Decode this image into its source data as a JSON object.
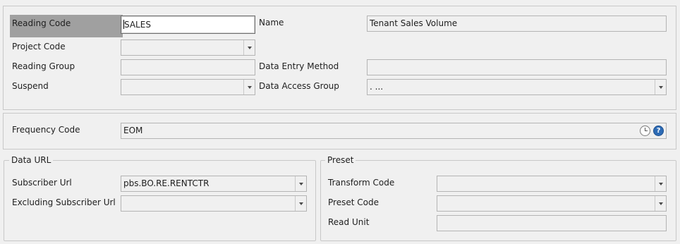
{
  "general": {
    "reading_code": {
      "label": "Reading Code",
      "value": "SALES"
    },
    "name": {
      "label": "Name",
      "value": "Tenant Sales Volume"
    },
    "project_code": {
      "label": "Project Code",
      "value": ""
    },
    "reading_group": {
      "label": "Reading Group",
      "value": ""
    },
    "data_entry_method": {
      "label": "Data Entry Method",
      "value": ""
    },
    "suspend": {
      "label": "Suspend",
      "value": ""
    },
    "data_access_group": {
      "label": "Data Access Group",
      "value": ". ..."
    }
  },
  "frequency": {
    "frequency_code": {
      "label": "Frequency Code",
      "value": "EOM"
    },
    "help_glyph": "?"
  },
  "data_url": {
    "legend": "Data URL",
    "subscriber_url": {
      "label": "Subscriber Url",
      "value": "pbs.BO.RE.RENTCTR"
    },
    "excluding_subscriber_url": {
      "label": "Excluding Subscriber Url",
      "value": ""
    }
  },
  "preset": {
    "legend": "Preset",
    "transform_code": {
      "label": "Transform Code",
      "value": ""
    },
    "preset_code": {
      "label": "Preset Code",
      "value": ""
    },
    "read_unit": {
      "label": "Read Unit",
      "value": ""
    }
  },
  "icons": {
    "dropdown": "chevron-down-icon",
    "clock": "clock-icon",
    "help": "help-icon"
  }
}
